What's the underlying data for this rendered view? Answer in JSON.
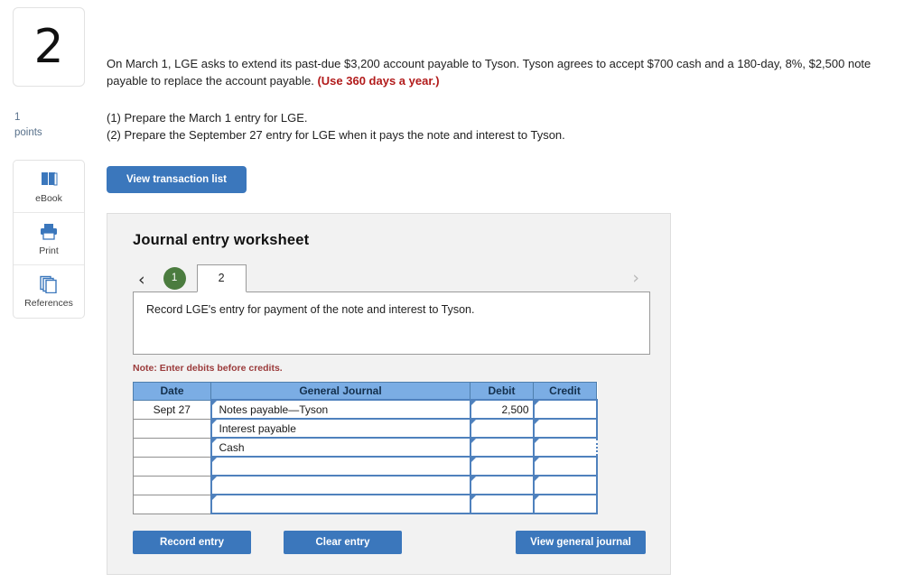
{
  "question": {
    "number": "2",
    "points_value": "1",
    "points_label": "points",
    "problem_line1": "On March 1, LGE asks to extend its past-due $3,200 account payable to Tyson. Tyson agrees to accept $700 cash and a 180-day, 8%, $2,500 note payable to replace the account payable.",
    "problem_emphasis": "(Use 360 days a year.)",
    "requirement1": "(1) Prepare the March 1 entry for LGE.",
    "requirement2": "(2) Prepare the September 27 entry for LGE when it pays the note and interest to Tyson."
  },
  "tools": [
    {
      "label": "eBook",
      "icon": "book-icon"
    },
    {
      "label": "Print",
      "icon": "printer-icon"
    },
    {
      "label": "References",
      "icon": "references-icon"
    }
  ],
  "buttons": {
    "view_transaction_list": "View transaction list",
    "record_entry": "Record entry",
    "clear_entry": "Clear entry",
    "view_general_journal": "View general journal"
  },
  "worksheet": {
    "title": "Journal entry worksheet",
    "prev_arrow": "‹",
    "next_arrow": "›",
    "tabs": [
      {
        "label": "1",
        "state": "completed"
      },
      {
        "label": "2",
        "state": "active"
      }
    ],
    "instruction": "Record LGE's entry for payment of the note and interest to Tyson.",
    "note": "Note: Enter debits before credits."
  },
  "journal": {
    "headers": [
      "Date",
      "General Journal",
      "Debit",
      "Credit"
    ],
    "rows": [
      {
        "date": "Sept 27",
        "account": "Notes payable—Tyson",
        "debit": "2,500",
        "credit": "",
        "credit_selected": false
      },
      {
        "date": "",
        "account": "Interest payable",
        "debit": "",
        "credit": "",
        "credit_selected": false
      },
      {
        "date": "",
        "account": "Cash",
        "debit": "",
        "credit": "",
        "credit_selected": true
      },
      {
        "date": "",
        "account": "",
        "debit": "",
        "credit": "",
        "credit_selected": false
      },
      {
        "date": "",
        "account": "",
        "debit": "",
        "credit": "",
        "credit_selected": false
      },
      {
        "date": "",
        "account": "",
        "debit": "",
        "credit": "",
        "credit_selected": false
      }
    ]
  },
  "colors": {
    "primary_button": "#3b77bc",
    "table_header": "#7badE4",
    "cell_border": "#4f81bd",
    "tab_completed": "#4b7c3f",
    "note_red": "#9b3b3b",
    "emphasis_red": "#b21b1b",
    "panel_bg": "#f2f2f2"
  }
}
